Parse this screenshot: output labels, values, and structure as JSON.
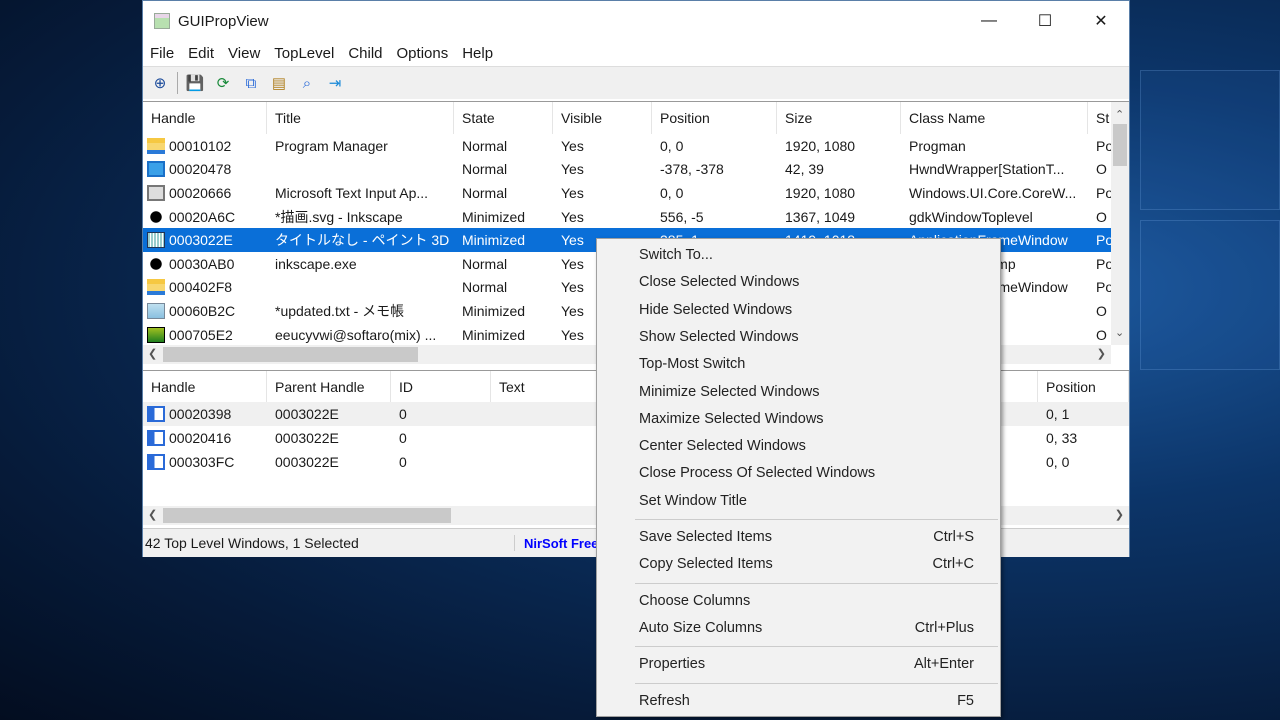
{
  "window": {
    "title": "GUIPropView",
    "controls": {
      "minimize": "—",
      "maximize": "☐",
      "close": "✕"
    }
  },
  "menubar": [
    "File",
    "Edit",
    "View",
    "TopLevel",
    "Child",
    "Options",
    "Help"
  ],
  "toolbar": [
    {
      "icon": "target-icon",
      "glyph": "⊕",
      "color": "#1a4a9a"
    },
    {
      "icon": "save-icon",
      "glyph": "💾",
      "color": "#1a3a9a"
    },
    {
      "icon": "refresh-icon",
      "glyph": "⟳",
      "color": "#1a8a3a"
    },
    {
      "icon": "copy-icon",
      "glyph": "⧉",
      "color": "#2a6ad8"
    },
    {
      "icon": "properties-icon",
      "glyph": "▤",
      "color": "#b08020"
    },
    {
      "icon": "find-icon",
      "glyph": "⌕",
      "color": "#2a6ad8"
    },
    {
      "icon": "exit-icon",
      "glyph": "⇥",
      "color": "#1a8ad8"
    }
  ],
  "top_list": {
    "columns": [
      "Handle",
      "Title",
      "State",
      "Visible",
      "Position",
      "Size",
      "Class Name",
      "St"
    ],
    "sort_indicator": "⁄",
    "rows": [
      {
        "icon": "folder-icon",
        "cells": [
          "00010102",
          "Program Manager",
          "Normal",
          "Yes",
          "0, 0",
          "1920, 1080",
          "Progman",
          "Po"
        ]
      },
      {
        "icon": "monitor-icon",
        "cells": [
          "00020478",
          "",
          "Normal",
          "Yes",
          "-378, -378",
          "42, 39",
          "HwndWrapper[StationT...",
          "O"
        ]
      },
      {
        "icon": "window-icon",
        "cells": [
          "00020666",
          "Microsoft Text Input Ap...",
          "Normal",
          "Yes",
          "0, 0",
          "1920, 1080",
          "Windows.UI.Core.CoreW...",
          "Po"
        ]
      },
      {
        "icon": "inkscape-icon",
        "cells": [
          "00020A6C",
          "*描画.svg - Inkscape",
          "Minimized",
          "Yes",
          "556, -5",
          "1367, 1049",
          "gdkWindowToplevel",
          "O"
        ]
      },
      {
        "icon": "paint3d-icon",
        "selected": true,
        "cells": [
          "0003022E",
          "タイトルなし - ペイント 3D",
          "Minimized",
          "Yes",
          "385, 1",
          "1419, 1018",
          "ApplicationFrameWindow",
          "Po"
        ]
      },
      {
        "icon": "inkscape-icon",
        "cells": [
          "00030AB0",
          "inkscape.exe",
          "Normal",
          "Yes",
          "",
          "",
          "gdkWindowTemp",
          "Po"
        ]
      },
      {
        "icon": "folder-icon",
        "cells": [
          "000402F8",
          "",
          "Normal",
          "Yes",
          "",
          "",
          "ApplicationFrameWindow",
          "Po"
        ]
      },
      {
        "icon": "notepad-icon",
        "cells": [
          "00060B2C",
          "*updated.txt - メモ帳",
          "Minimized",
          "Yes",
          "",
          "",
          "",
          "O"
        ]
      },
      {
        "icon": "ftp-icon",
        "cells": [
          "000705E2",
          "eeucyvwi@softaro(mix) ...",
          "Minimized",
          "Yes",
          "",
          "",
          "",
          "O"
        ]
      }
    ]
  },
  "bottom_list": {
    "columns": [
      "Handle",
      "Parent Handle",
      "ID",
      "Text",
      "Position"
    ],
    "rows": [
      {
        "cells": [
          "00020398",
          "0003022E",
          "0",
          "",
          "0, 1"
        ]
      },
      {
        "cells": [
          "00020416",
          "0003022E",
          "0",
          "",
          "0, 33"
        ]
      },
      {
        "cells": [
          "000303FC",
          "0003022E",
          "0",
          "",
          "0, 0"
        ]
      }
    ]
  },
  "status": {
    "left": "42 Top Level Windows, 1 Selected",
    "link": "NirSoft Freeware",
    "link_color": "#0000ff"
  },
  "context_menu": {
    "groups": [
      [
        {
          "label": "Switch To..."
        },
        {
          "label": "Close Selected Windows"
        },
        {
          "label": "Hide Selected Windows"
        },
        {
          "label": "Show Selected Windows"
        },
        {
          "label": "Top-Most Switch"
        },
        {
          "label": "Minimize Selected Windows"
        },
        {
          "label": "Maximize Selected Windows"
        },
        {
          "label": "Center Selected Windows"
        },
        {
          "label": "Close Process Of Selected Windows"
        },
        {
          "label": "Set Window Title"
        }
      ],
      [
        {
          "label": "Save Selected Items",
          "shortcut": "Ctrl+S"
        },
        {
          "label": "Copy Selected Items",
          "shortcut": "Ctrl+C"
        }
      ],
      [
        {
          "label": "Choose Columns"
        },
        {
          "label": "Auto Size Columns",
          "shortcut": "Ctrl+Plus"
        }
      ],
      [
        {
          "label": "Properties",
          "shortcut": "Alt+Enter"
        }
      ],
      [
        {
          "label": "Refresh",
          "shortcut": "F5"
        }
      ]
    ]
  },
  "colors": {
    "selection": "#0a6fd8",
    "accent": "#0a6fd8"
  }
}
